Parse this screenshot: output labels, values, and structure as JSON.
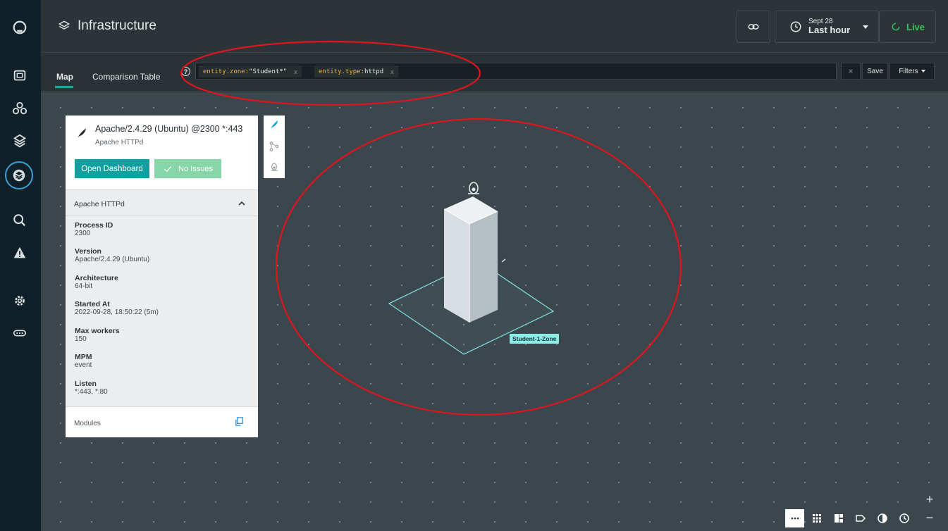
{
  "header": {
    "title": "Infrastructure",
    "time_date": "Sept 28",
    "time_range": "Last hour",
    "live_label": "Live"
  },
  "tabs": [
    {
      "label": "Map",
      "active": true
    },
    {
      "label": "Comparison Table",
      "active": false
    }
  ],
  "filter": {
    "help": "?",
    "chips": [
      {
        "key": "entity.zone:",
        "value": "\"Student*\"",
        "remove": "x"
      },
      {
        "key": "entity.type:",
        "value": "httpd",
        "remove": "x"
      }
    ],
    "clear": "×",
    "save_label": "Save",
    "filters_label": "Filters"
  },
  "panel": {
    "title": "Apache/2.4.29 (Ubuntu) @2300 *:443",
    "subtitle": "Apache HTTPd",
    "open_dashboard": "Open Dashboard",
    "status": "No Issues",
    "section_title": "Apache HTTPd",
    "attributes": [
      {
        "label": "Process ID",
        "value": "2300"
      },
      {
        "label": "Version",
        "value": "Apache/2.4.29 (Ubuntu)"
      },
      {
        "label": "Architecture",
        "value": "64-bit"
      },
      {
        "label": "Started At",
        "value": "2022-09-28, 18:50:22 (5m)"
      },
      {
        "label": "Max workers",
        "value": "150"
      },
      {
        "label": "MPM",
        "value": "event"
      },
      {
        "label": "Listen",
        "value": "*:443, *:80"
      }
    ],
    "modules_label": "Modules"
  },
  "map": {
    "zone_label": "Student-1-Zone"
  },
  "controls": {
    "zoom_in": "+",
    "zoom_out": "−"
  },
  "colors": {
    "accent": "#11a0a0",
    "live": "#37c35f",
    "annotation": "#e0141e",
    "zone": "#8beee9"
  }
}
